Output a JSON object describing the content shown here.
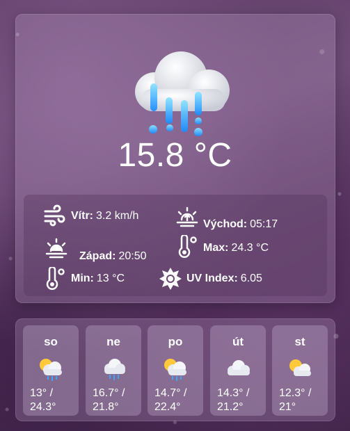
{
  "current": {
    "temperature": "15.8 °C",
    "icon": "rain-cloud-icon"
  },
  "details": {
    "wind_label": "Vítr:",
    "wind_value": "3.2 km/h",
    "sunrise_label": "Východ:",
    "sunrise_value": "05:17",
    "sunset_label": "Západ:",
    "sunset_value": "20:50",
    "max_label": "Max:",
    "max_value": "24.3 °C",
    "min_label": "Min:",
    "min_value": "13 °C",
    "uv_label": "UV Index:",
    "uv_value": "6.05"
  },
  "forecast": [
    {
      "day": "so",
      "icon": "sun-cloud-rain-icon",
      "low": "13° /",
      "high": "24.3°"
    },
    {
      "day": "ne",
      "icon": "cloud-rain-icon",
      "low": "16.7° /",
      "high": "21.8°"
    },
    {
      "day": "po",
      "icon": "sun-cloud-rain-icon",
      "low": "14.7° /",
      "high": "22.4°"
    },
    {
      "day": "út",
      "icon": "cloud-icon",
      "low": "14.3° /",
      "high": "21.2°"
    },
    {
      "day": "st",
      "icon": "sun-cloud-icon",
      "low": "12.3° /",
      "high": "21°"
    }
  ]
}
